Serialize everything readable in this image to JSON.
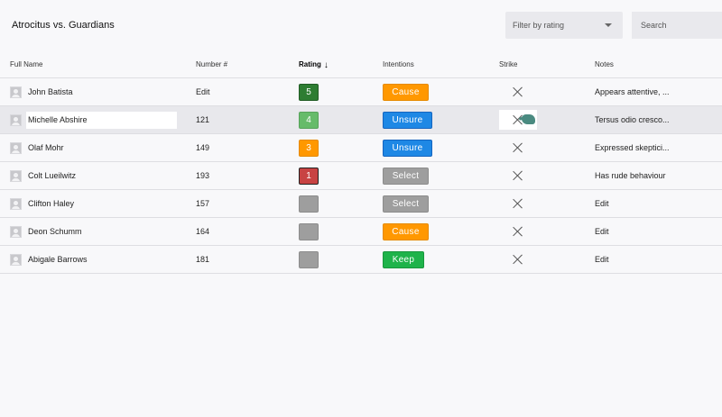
{
  "title": "Atrocitus vs. Guardians",
  "filter": {
    "placeholder": "Filter by rating",
    "icon": "caret-down-icon"
  },
  "search": {
    "placeholder": "Search"
  },
  "columns": [
    "Full Name",
    "Number #",
    "Rating",
    "Intentions",
    "Strike",
    "Notes"
  ],
  "sort": {
    "column": "Rating",
    "direction": "descending"
  },
  "rows": [
    {
      "name": "John Batista",
      "number": "Edit",
      "rating": "5",
      "intention": "Cause",
      "notes": "Appears attentive, ..."
    },
    {
      "name": "Michelle Abshire",
      "number": "121",
      "rating": "4",
      "intention": "Unsure",
      "notes": "Tersus odio cresco..."
    },
    {
      "name": "Olaf Mohr",
      "number": "149",
      "rating": "3",
      "intention": "Unsure",
      "notes": "Expressed skeptici..."
    },
    {
      "name": "Colt Lueilwitz",
      "number": "193",
      "rating": "1",
      "intention": "Select",
      "notes": "Has rude behaviour"
    },
    {
      "name": "Clifton Haley",
      "number": "157",
      "rating": "",
      "intention": "Select",
      "notes": "Edit"
    },
    {
      "name": "Deon Schumm",
      "number": "164",
      "rating": "",
      "intention": "Cause",
      "notes": "Edit"
    },
    {
      "name": "Abigale Barrows",
      "number": "181",
      "rating": "",
      "intention": "Keep",
      "notes": "Edit"
    }
  ],
  "colors": {
    "rating_5": "#2e7d32",
    "rating_4": "#66bb6a",
    "rating_3": "#ff9800",
    "rating_1": "#c84343",
    "rating_empty": "#9e9e9e",
    "cause": "#ff9800",
    "unsure": "#1e88e5",
    "select": "#9e9e9e",
    "keep": "#1fb34a"
  }
}
